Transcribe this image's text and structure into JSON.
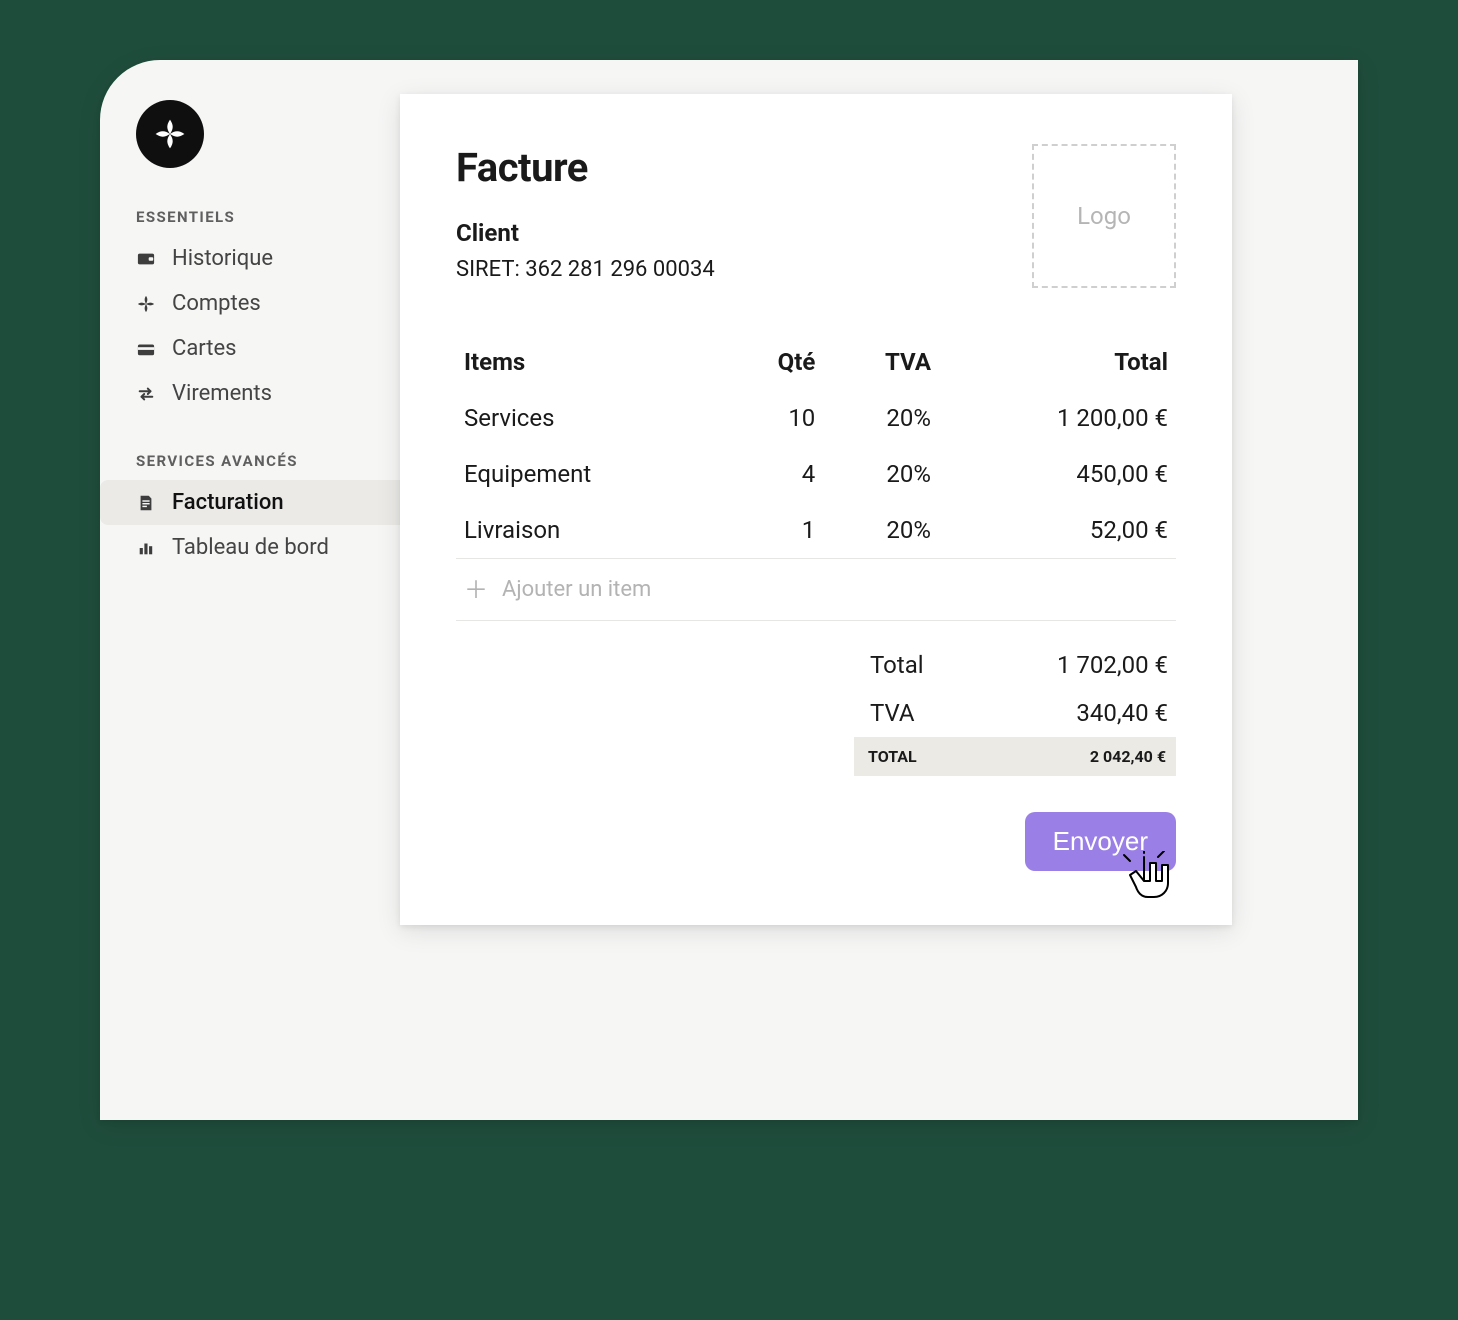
{
  "sidebar": {
    "sections": [
      {
        "title": "ESSENTIELS",
        "items": [
          {
            "label": "Historique",
            "active": false
          },
          {
            "label": "Comptes",
            "active": false
          },
          {
            "label": "Cartes",
            "active": false
          },
          {
            "label": "Virements",
            "active": false
          }
        ]
      },
      {
        "title": "SERVICES AVANCÉS",
        "items": [
          {
            "label": "Facturation",
            "active": true
          },
          {
            "label": "Tableau de bord",
            "active": false
          }
        ]
      }
    ]
  },
  "invoice": {
    "title": "Facture",
    "client_label": "Client",
    "siret": "SIRET: 362 281 296 00034",
    "logo_placeholder": "Logo",
    "headers": {
      "items": "Items",
      "qty": "Qté",
      "vat": "TVA",
      "total": "Total"
    },
    "lines": [
      {
        "name": "Services",
        "qty": "10",
        "vat": "20%",
        "total": "1 200,00 €"
      },
      {
        "name": "Equipement",
        "qty": "4",
        "vat": "20%",
        "total": "450,00 €"
      },
      {
        "name": "Livraison",
        "qty": "1",
        "vat": "20%",
        "total": "52,00 €"
      }
    ],
    "add_item_label": "Ajouter un item",
    "totals": {
      "subtotal_label": "Total",
      "subtotal_value": "1 702,00 €",
      "vat_label": "TVA",
      "vat_value": "340,40 €",
      "grand_label": "TOTAL",
      "grand_value": "2 042,40 €"
    },
    "send_label": "Envoyer"
  },
  "colors": {
    "accent": "#9a80e6"
  }
}
